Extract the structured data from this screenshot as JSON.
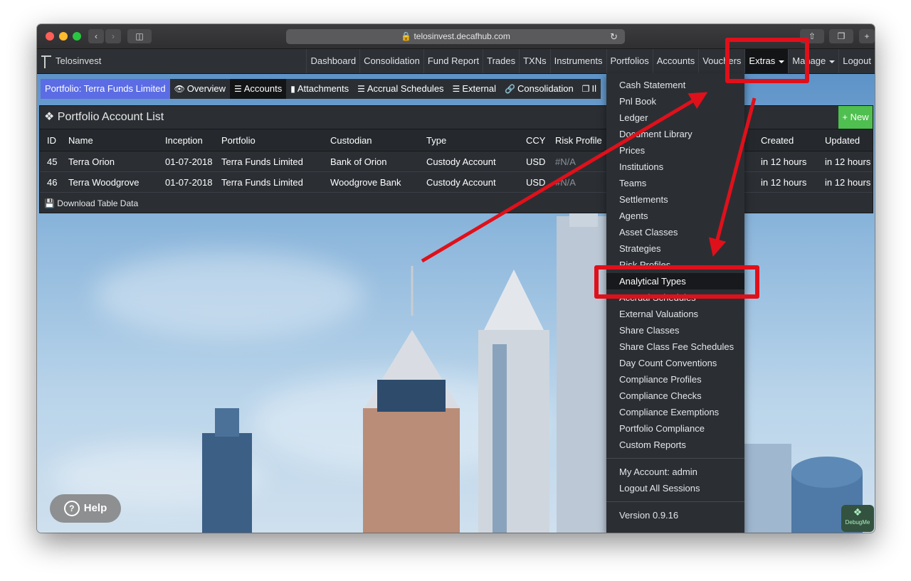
{
  "browser": {
    "url": "telosinvest.decafhub.com"
  },
  "navbar": {
    "brand": "Telosinvest",
    "items": [
      "Dashboard",
      "Consolidation",
      "Fund Report",
      "Trades",
      "TXNs",
      "Instruments",
      "Portfolios",
      "Accounts",
      "Vouchers",
      "Extras",
      "Manage",
      "Logout"
    ]
  },
  "subtabs": {
    "portfolio": "Portfolio: Terra Funds Limited",
    "overview": "Overview",
    "accounts": "Accounts",
    "attachments": "Attachments",
    "accrual": "Accrual Schedules",
    "external": "External",
    "consolidation": "Consolidation",
    "partial": "Il"
  },
  "panel": {
    "title": "Portfolio Account List",
    "new_label": "New",
    "columns": [
      "ID",
      "Name",
      "Inception",
      "Portfolio",
      "Custodian",
      "Type",
      "CCY",
      "Risk Profile",
      "Created",
      "Updated"
    ],
    "rows": [
      {
        "id": "45",
        "name": "Terra Orion",
        "inception": "01-07-2018",
        "portfolio": "Terra Funds Limited",
        "custodian": "Bank of Orion",
        "type": "Custody Account",
        "ccy": "USD",
        "risk": "#N/A",
        "created": "in 12 hours",
        "updated": "in 12 hours"
      },
      {
        "id": "46",
        "name": "Terra Woodgrove",
        "inception": "01-07-2018",
        "portfolio": "Terra Funds Limited",
        "custodian": "Woodgrove Bank",
        "type": "Custody Account",
        "ccy": "USD",
        "risk": "#N/A",
        "created": "in 12 hours",
        "updated": "in 12 hours"
      }
    ],
    "download_label": "Download Table Data"
  },
  "dropdown": {
    "items": [
      "Cash Statement",
      "Pnl Book",
      "Ledger",
      "Document Library",
      "Prices",
      "Institutions",
      "Teams",
      "Settlements",
      "Agents",
      "Asset Classes",
      "Strategies",
      "Risk Profiles",
      "Analytical Types",
      "Accrual Schedules",
      "External Valuations",
      "Share Classes",
      "Share Class Fee Schedules",
      "Day Count Conventions",
      "Compliance Profiles",
      "Compliance Checks",
      "Compliance Exemptions",
      "Portfolio Compliance",
      "Custom Reports"
    ],
    "account": "My Account: admin",
    "logout_all": "Logout All Sessions",
    "version": "Version 0.9.16"
  },
  "help_label": "Help",
  "debug_label": "DebugMe",
  "colors": {
    "highlight": "#e0101a",
    "portfolio_tab": "#5b6ce4",
    "new_button": "#4fbf4f"
  }
}
